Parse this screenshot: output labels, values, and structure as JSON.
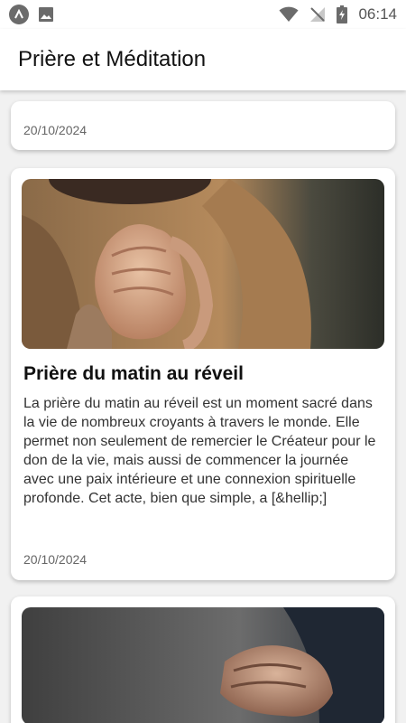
{
  "status_bar": {
    "time": "06:14",
    "icons": [
      "app-launcher-icon",
      "image-icon",
      "wifi-icon",
      "no-signal-icon",
      "battery-icon"
    ]
  },
  "app_bar": {
    "title": "Prière et Méditation"
  },
  "feed": {
    "items": [
      {
        "date": "20/10/2024"
      },
      {
        "title": "Prière du matin au réveil",
        "excerpt": "La prière du matin au réveil est un moment sacré dans la vie de nombreux croyants à travers le monde. Elle permet non seulement de remercier le Créateur pour le don de la vie, mais aussi de commencer la journée avec une paix intérieure et une connexion spirituelle profonde. Cet acte, bien que simple, a [&hellip;]",
        "date": "20/10/2024",
        "image": "praying-hands-photo"
      },
      {
        "image": "praying-hands-photo-2"
      }
    ]
  },
  "colors": {
    "background": "#f1f1f1",
    "card": "#ffffff",
    "date_text": "#666666"
  }
}
